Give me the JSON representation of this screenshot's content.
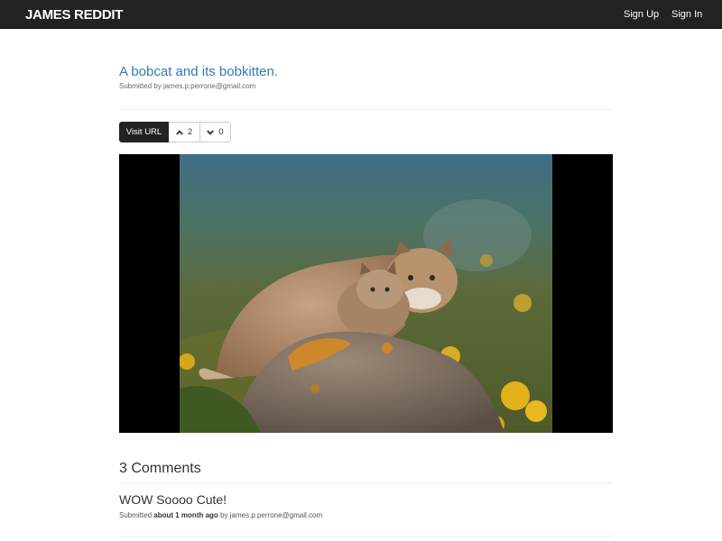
{
  "navbar": {
    "brand": "JAMES REDDIT",
    "sign_up": "Sign Up",
    "sign_in": "Sign In"
  },
  "post": {
    "title": "A bobcat and its bobkitten.",
    "submitted_prefix": "Submitted by",
    "author": "james.p.perrone@gmail.com",
    "visit_url_label": "Visit URL",
    "upvotes": "2",
    "downvotes": "0"
  },
  "comments": {
    "heading": "3 Comments",
    "items": [
      {
        "body": "WOW Soooo Cute!",
        "submitted_prefix": "Submitted",
        "time": "about 1 month ago",
        "by_prefix": "by",
        "author": "james.p.perrone@gmail.com"
      }
    ]
  },
  "icons": {
    "upvote": "chevron-up-icon",
    "downvote": "chevron-down-icon"
  },
  "colors": {
    "navbar_bg": "#222222",
    "link": "#337ab7",
    "visit_button_bg": "#222222"
  }
}
